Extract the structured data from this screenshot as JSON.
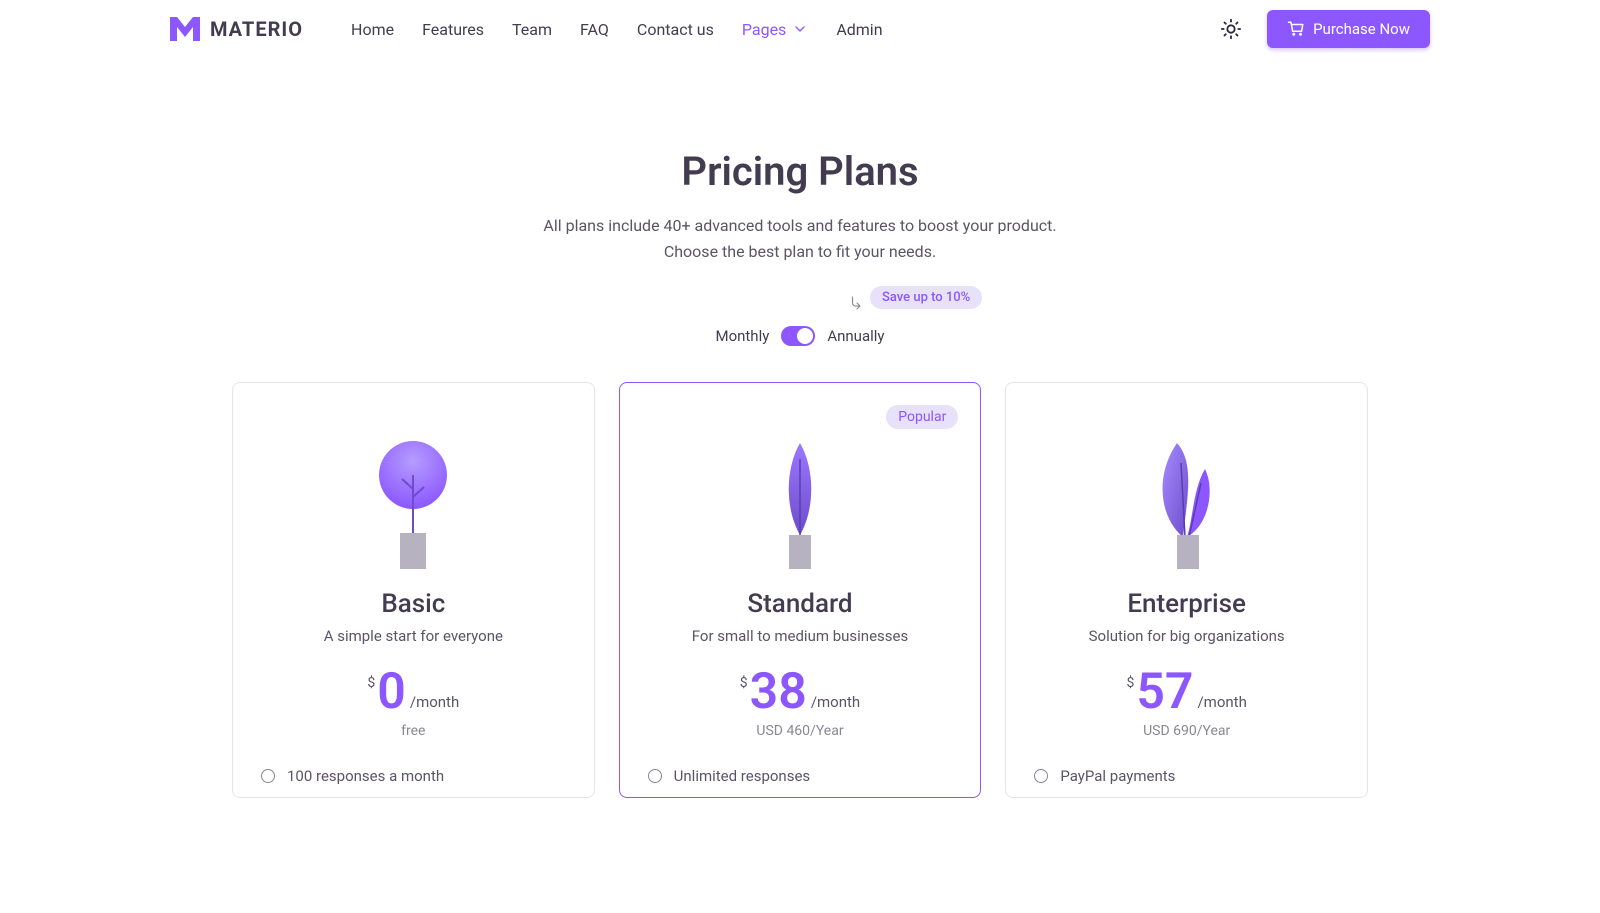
{
  "brand": {
    "name": "MATERIO"
  },
  "nav": {
    "items": [
      {
        "label": "Home",
        "active": false
      },
      {
        "label": "Features",
        "active": false
      },
      {
        "label": "Team",
        "active": false
      },
      {
        "label": "FAQ",
        "active": false
      },
      {
        "label": "Contact us",
        "active": false
      },
      {
        "label": "Pages",
        "active": true,
        "dropdown": true
      },
      {
        "label": "Admin",
        "active": false
      }
    ],
    "cta": "Purchase Now"
  },
  "header": {
    "title": "Pricing Plans",
    "subtitle_line1": "All plans include 40+ advanced tools and features to boost your product.",
    "subtitle_line2": "Choose the best plan to fit your needs."
  },
  "toggle": {
    "left": "Monthly",
    "right": "Annually",
    "save_label": "Save up to 10%",
    "annual_selected": true
  },
  "currency": "$",
  "period_label": "/month",
  "plans": [
    {
      "name": "Basic",
      "subtitle": "A simple start for everyone",
      "price": "0",
      "year_label": "free",
      "popular": false,
      "features": [
        "100 responses a month"
      ]
    },
    {
      "name": "Standard",
      "subtitle": "For small to medium businesses",
      "price": "38",
      "year_label": "USD 460/Year",
      "popular": true,
      "popular_label": "Popular",
      "features": [
        "Unlimited responses"
      ]
    },
    {
      "name": "Enterprise",
      "subtitle": "Solution for big organizations",
      "price": "57",
      "year_label": "USD 690/Year",
      "popular": false,
      "features": [
        "PayPal payments"
      ]
    }
  ]
}
